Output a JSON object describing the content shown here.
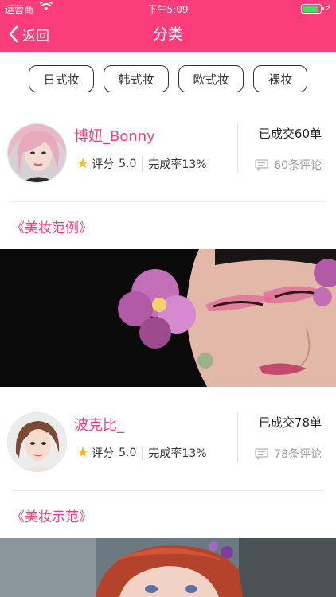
{
  "status_bar": {
    "carrier": "运营商",
    "time": "下午5:09",
    "battery_level": 0.9
  },
  "nav": {
    "back_label": "返回",
    "title": "分类"
  },
  "filters": [
    "日式妆",
    "韩式妆",
    "欧式妆",
    "裸妆"
  ],
  "artists": [
    {
      "name": "博妞_Bonny",
      "rating_label": "评分",
      "rating": "5.0",
      "completion": "完成率13%",
      "deals": "已成交60单",
      "comments": "60条评论",
      "section_title": "《美妆范例》"
    },
    {
      "name": "波克比_",
      "rating_label": "评分",
      "rating": "5.0",
      "completion": "完成率13%",
      "deals": "已成交78单",
      "comments": "78条评论",
      "section_title": "《美妆示范》"
    }
  ],
  "colors": {
    "brand": "#FB3D7C",
    "star": "#F7BC1B",
    "battery": "#4CD964"
  }
}
